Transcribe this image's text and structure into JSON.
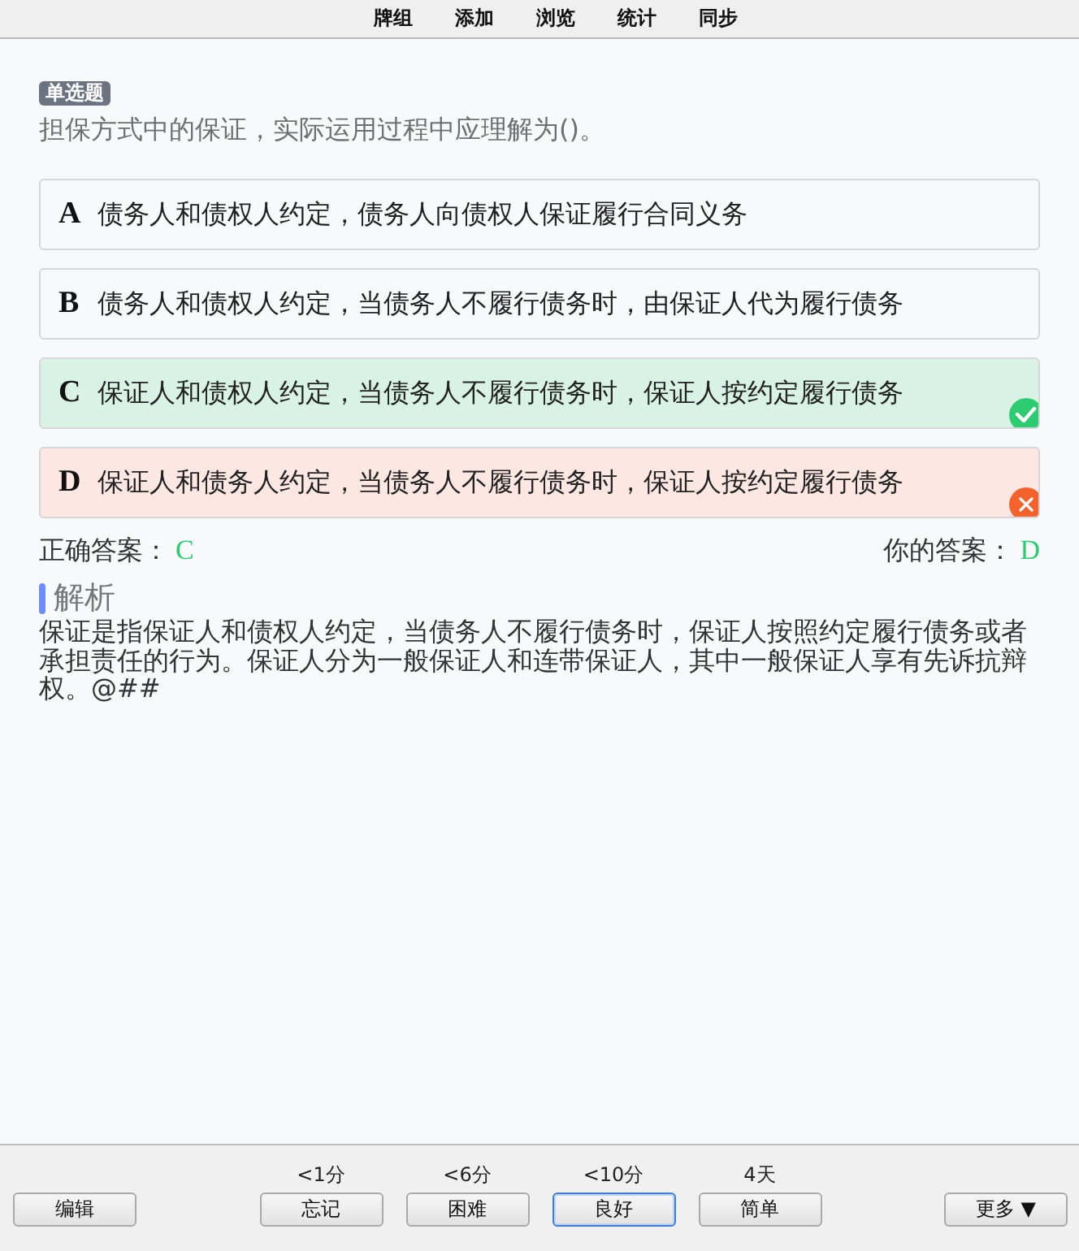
{
  "top_menu": [
    "牌组",
    "添加",
    "浏览",
    "统计",
    "同步"
  ],
  "question": {
    "type_badge": "单选题",
    "text": "担保方式中的保证，实际运用过程中应理解为()。"
  },
  "options": [
    {
      "letter": "A",
      "text": "债务人和债权人约定，债务人向债权人保证履行合同义务",
      "kind": "plain"
    },
    {
      "letter": "B",
      "text": "债务人和债权人约定，当债务人不履行债务时，由保证人代为履行债务",
      "kind": "plain"
    },
    {
      "letter": "C",
      "text": "保证人和债权人约定，当债务人不履行债务时，保证人按约定履行债务",
      "kind": "correct"
    },
    {
      "letter": "D",
      "text": "保证人和债务人约定，当债务人不履行债务时，保证人按约定履行债务",
      "kind": "wrong"
    }
  ],
  "answers": {
    "correct_label": "正确答案：",
    "correct_value": "C",
    "yours_label": "你的答案：",
    "yours_value": "D"
  },
  "explanation": {
    "heading": "解析",
    "text": "保证是指保证人和债权人约定，当债务人不履行债务时，保证人按照约定履行债务或者承担责任的行为。保证人分为一般保证人和连带保证人，其中一般保证人享有先诉抗辩权。@##"
  },
  "bottom_bar": {
    "edit_button": "编辑",
    "ease_buttons": [
      {
        "time": "<1分",
        "label": "忘记",
        "focused": false
      },
      {
        "time": "<6分",
        "label": "困难",
        "focused": false
      },
      {
        "time": "<10分",
        "label": "良好",
        "focused": true
      },
      {
        "time": "4天",
        "label": "简单",
        "focused": false
      }
    ],
    "more_button": "更多 ▼"
  }
}
